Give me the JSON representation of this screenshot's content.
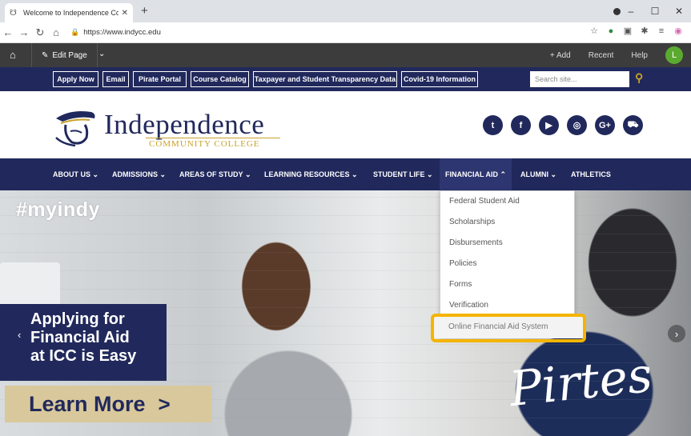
{
  "browser": {
    "tab_title": "Welcome to Independence Comm",
    "tab_close": "✕",
    "new_tab": "+",
    "url": "https://www.indycc.edu",
    "window_controls": [
      "–",
      "☐",
      "✕"
    ]
  },
  "cms_bar": {
    "edit_page": "Edit Page",
    "add": "+ Add",
    "recent": "Recent",
    "help": "Help",
    "avatar_letter": "L"
  },
  "utility_bar": {
    "buttons": [
      "Apply Now",
      "Email",
      "Pirate Portal",
      "Course Catalog",
      "Taxpayer and Student Transparency Data",
      "Covid-19 Information"
    ],
    "search_placeholder": "Search site..."
  },
  "header": {
    "name": "Independence",
    "subtitle": "COMMUNITY COLLEGE",
    "social_icons": [
      "twitter-icon",
      "facebook-icon",
      "youtube-icon",
      "instagram-icon",
      "google-plus-icon",
      "cart-icon"
    ]
  },
  "main_nav": {
    "items": [
      "ABOUT US",
      "ADMISSIONS",
      "AREAS OF STUDY",
      "LEARNING RESOURCES",
      "STUDENT LIFE",
      "FINANCIAL AID",
      "ALUMNI",
      "ATHLETICS"
    ]
  },
  "dropdown": {
    "items": [
      "Federal Student Aid",
      "Scholarships",
      "Disbursements",
      "Policies",
      "Forms",
      "Verification",
      "Online Financial Aid System"
    ],
    "highlighted": "Online Financial Aid System"
  },
  "hero": {
    "hashtag": "#myindy",
    "promo_lines": [
      "Applying for",
      "Financial Aid",
      "at ICC is Easy"
    ],
    "cta": "Learn More",
    "script_text": "Pirtes"
  },
  "colors": {
    "navy": "#21295c",
    "gold": "#c9a227",
    "highlight": "#f5b400"
  }
}
